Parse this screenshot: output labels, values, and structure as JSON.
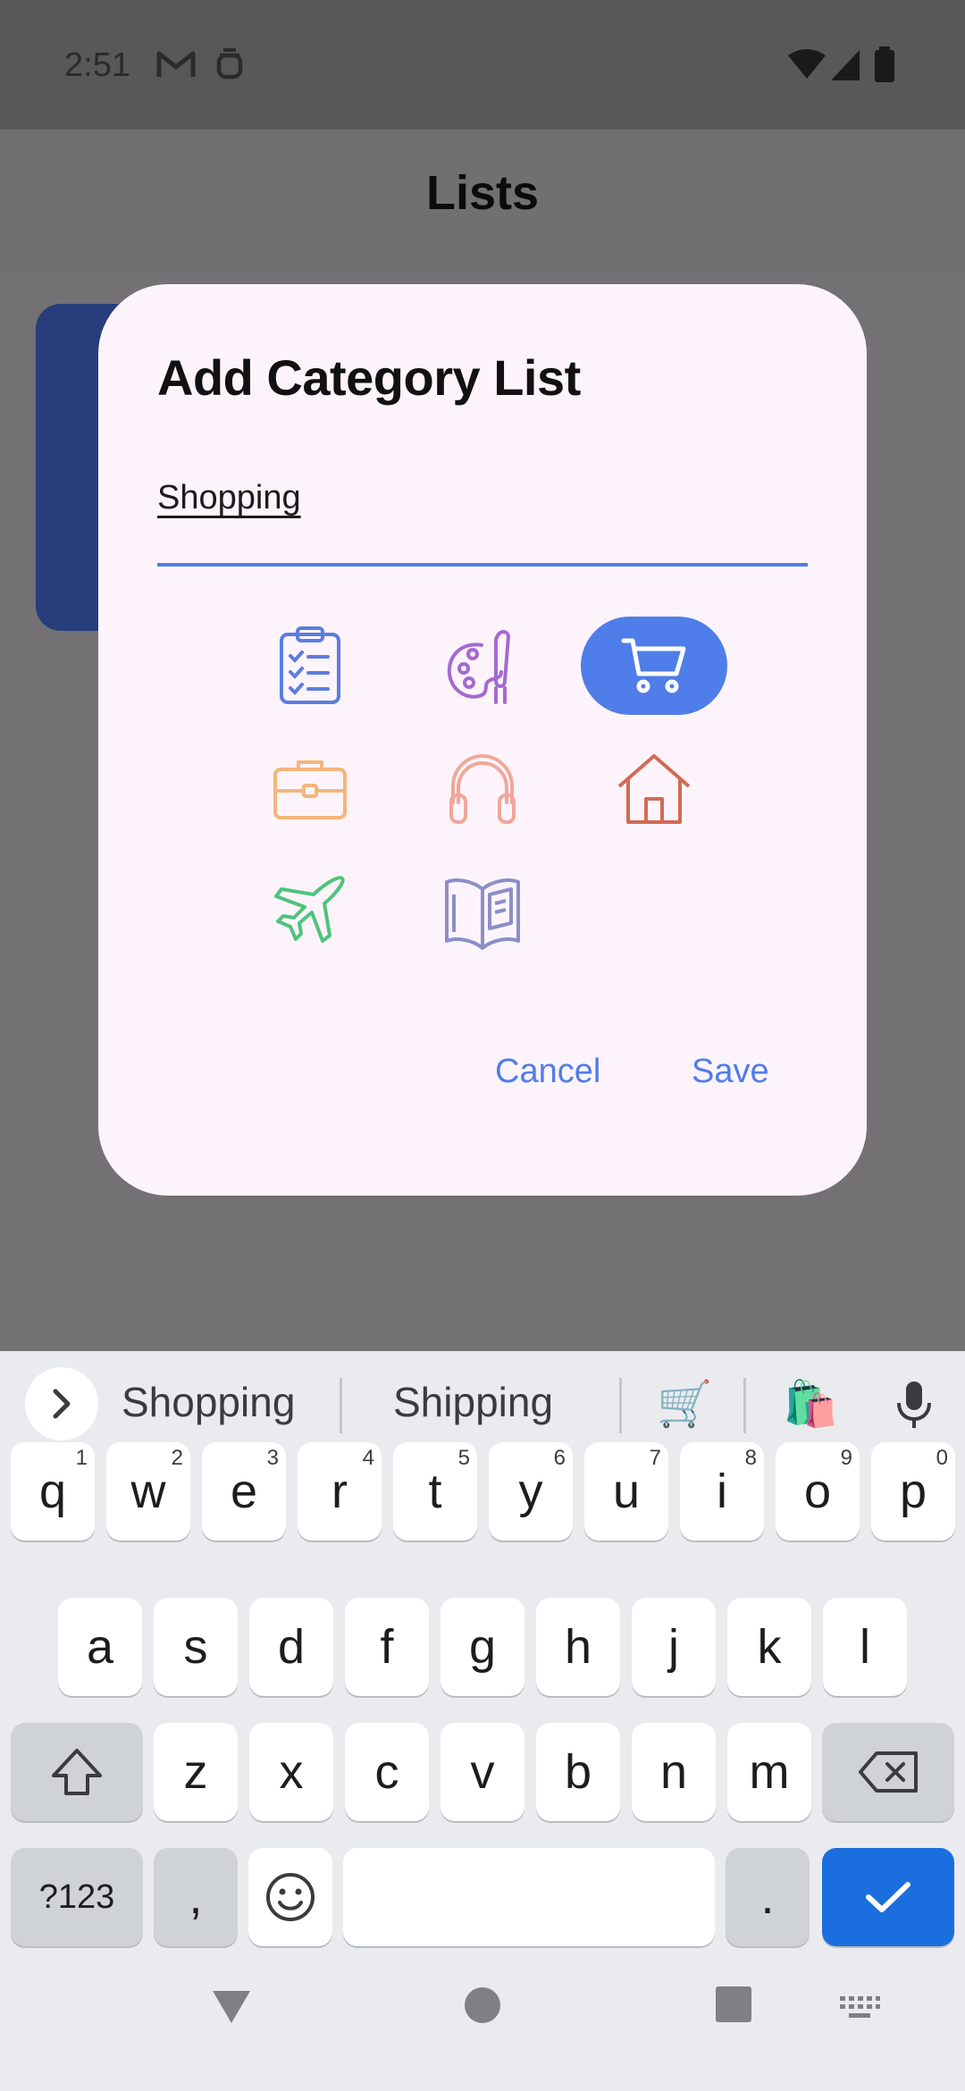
{
  "status_bar": {
    "time": "2:51",
    "left_icons": [
      "gmail-icon",
      "app-notification-icon"
    ],
    "right_icons": [
      "wifi-icon",
      "cell-signal-icon",
      "battery-icon"
    ]
  },
  "app_bar": {
    "title": "Lists"
  },
  "dialog": {
    "title": "Add Category List",
    "input_value": "Shopping",
    "icons": [
      {
        "name": "clipboard-checklist-icon",
        "color": "#5a7de0",
        "selected": false
      },
      {
        "name": "palette-brush-icon",
        "color": "#a46ad0",
        "selected": false
      },
      {
        "name": "shopping-cart-icon",
        "color": "#ffffff",
        "selected": true
      },
      {
        "name": "briefcase-icon",
        "color": "#f4b57a",
        "selected": false
      },
      {
        "name": "headphones-icon",
        "color": "#f0a79a",
        "selected": false
      },
      {
        "name": "house-icon",
        "color": "#d26a55",
        "selected": false
      },
      {
        "name": "airplane-icon",
        "color": "#4ec47c",
        "selected": false
      },
      {
        "name": "open-book-icon",
        "color": "#8b8fc8",
        "selected": false
      }
    ],
    "cancel_label": "Cancel",
    "save_label": "Save",
    "accent_color": "#4f7de9",
    "background": "#fdf4fb"
  },
  "keyboard": {
    "suggestions": [
      "Shopping",
      "Shipping"
    ],
    "suggestion_emojis": [
      "🛒",
      "🛍️"
    ],
    "row1": [
      "q",
      "w",
      "e",
      "r",
      "t",
      "y",
      "u",
      "i",
      "o",
      "p"
    ],
    "row1_numbers": [
      "1",
      "2",
      "3",
      "4",
      "5",
      "6",
      "7",
      "8",
      "9",
      "0"
    ],
    "row2": [
      "a",
      "s",
      "d",
      "f",
      "g",
      "h",
      "j",
      "k",
      "l"
    ],
    "row3": [
      "z",
      "x",
      "c",
      "v",
      "b",
      "n",
      "m"
    ],
    "symbols_label": "?123",
    "comma_label": ",",
    "period_label": ".",
    "enter_color": "#1a6ede"
  },
  "nav_bar": {
    "icons": [
      "back-icon",
      "home-icon",
      "recents-icon",
      "keyboard-switch-icon"
    ]
  }
}
